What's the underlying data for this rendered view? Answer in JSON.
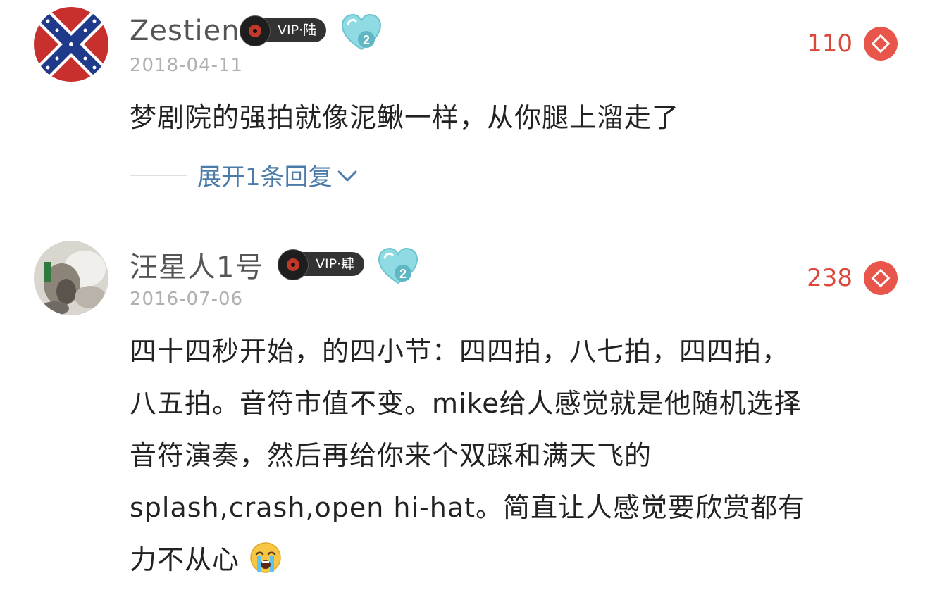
{
  "comments": [
    {
      "username": "Zestien",
      "vip_label": "VIP·陆",
      "heart_level": "2",
      "date": "2018-04-11",
      "likes": "110",
      "text": "梦剧院的强拍就像泥鳅一样，从你腿上溜走了",
      "expand_label": "展开1条回复",
      "avatar": "confederate-flag-avatar"
    },
    {
      "username": "汪星人1号",
      "vip_label": "VIP·肆",
      "heart_level": "2",
      "date": "2016-07-06",
      "likes": "238",
      "text_lines": [
        "四十四秒开始，的四小节：四四拍，八七拍，四四拍，",
        "八五拍。音符市值不变。mike给人感觉就是他随机选择",
        "音符演奏，然后再给你来个双踩和满天飞的",
        "splash,crash,open hi-hat。简直让人感觉要欣赏都有",
        "力不从心"
      ],
      "emoji": "crying-face-emoji",
      "avatar": "dog-photo-avatar"
    }
  ],
  "colors": {
    "like_red": "#e8554a",
    "link_blue": "#4a7bab",
    "date_gray": "#b0b0b0",
    "heart_teal": "#7fd3dd"
  }
}
